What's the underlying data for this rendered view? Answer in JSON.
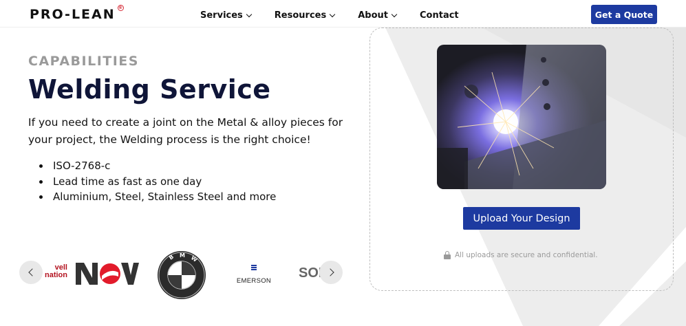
{
  "header": {
    "logo": "PRO-LEAN",
    "logo_reg": "®",
    "nav": [
      {
        "label": "Services",
        "has_dropdown": true
      },
      {
        "label": "Resources",
        "has_dropdown": true
      },
      {
        "label": "About",
        "has_dropdown": true
      },
      {
        "label": "Contact",
        "has_dropdown": false
      }
    ],
    "cta_label": "Get a Quote"
  },
  "hero": {
    "eyebrow": "CAPABILITIES",
    "title": "Welding Service",
    "description": "If you need to create a joint on the Metal & alloy pieces for your project, the Welding process is the right choice!",
    "bullets": [
      "ISO-2768-c",
      "Lead time as fast as one day",
      "Aluminium, Steel, Stainless Steel and more"
    ]
  },
  "carousel": {
    "brands": [
      {
        "name": "rockwell-automation-logo",
        "text_1": "vell",
        "text_2": "nation"
      },
      {
        "name": "nov-logo",
        "text": "NOV"
      },
      {
        "name": "bmw-logo",
        "text": "BMW"
      },
      {
        "name": "emerson-logo",
        "text": "EMERSON"
      },
      {
        "name": "solidworks-logo",
        "text": "SOL"
      }
    ]
  },
  "upload": {
    "button_label": "Upload Your Design",
    "secure_note": "All uploads are secure and confidential."
  },
  "colors": {
    "brand_blue": "#1d3aa0",
    "title_navy": "#0f1538",
    "eyebrow_gray": "#9a9a9a",
    "logo_red": "#d62a36"
  },
  "icons": {
    "chevron": "chevron-down-icon",
    "prev": "chevron-left-icon",
    "next": "chevron-right-icon",
    "lock": "lock-icon"
  }
}
